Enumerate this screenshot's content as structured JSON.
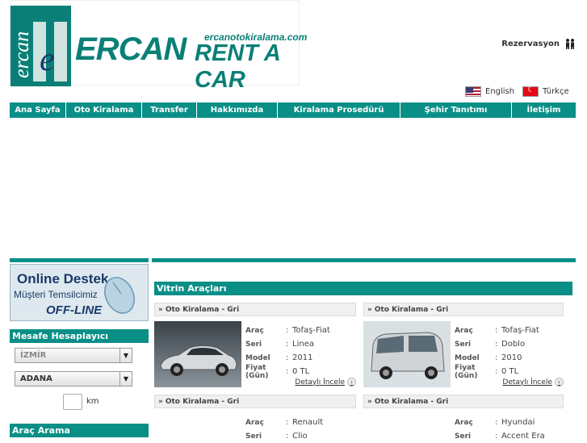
{
  "logo": {
    "mark_text": "ercan",
    "mark_letter": "e",
    "brand": "ERCAN",
    "domain": "ercanotokiralama.com",
    "tagline": "RENT A CAR"
  },
  "header": {
    "reservation_label": "Rezervasyon",
    "reservation_icon": "people-icon",
    "languages": [
      {
        "label": "English",
        "flag": "us-flag-icon"
      },
      {
        "label": "Türkçe",
        "flag": "tr-flag-icon"
      }
    ]
  },
  "nav": [
    {
      "label": "Ana Sayfa"
    },
    {
      "label": "Oto Kiralama"
    },
    {
      "label": "Transfer"
    },
    {
      "label": "Hakkımızda"
    },
    {
      "label": "Kiralama Prosedürü"
    },
    {
      "label": "Şehir Tanıtımı"
    },
    {
      "label": "İletişim"
    }
  ],
  "sidebar": {
    "support": {
      "title": "Online Destek",
      "subtitle": "Müşteri Temsilcimiz",
      "status": "OFF-LINE"
    },
    "distance": {
      "title": "Mesafe Hesaplayıcı",
      "from": "İZMİR",
      "to": "ADANA",
      "km_value": "",
      "km_unit": "km"
    },
    "search": {
      "title": "Araç Arama"
    }
  },
  "vitrin": {
    "title": "Vitrin Araçları",
    "cards": [
      {
        "header": "Oto Kiralama - Gri",
        "arac_label": "Araç",
        "arac": "Tofaş-Fiat",
        "seri_label": "Seri",
        "seri": "Linea",
        "model_label": "Model",
        "model": "2011",
        "fiyat_label": "Fiyat (Gün)",
        "fiyat": "0 TL",
        "detail": "Detaylı İncele"
      },
      {
        "header": "Oto Kiralama - Gri",
        "arac_label": "Araç",
        "arac": "Tofaş-Fiat",
        "seri_label": "Seri",
        "seri": "Doblo",
        "model_label": "Model",
        "model": "2010",
        "fiyat_label": "Fiyat (Gün)",
        "fiyat": "0 TL",
        "detail": "Detaylı İncele"
      },
      {
        "header": "Oto Kiralama - Gri",
        "arac_label": "Araç",
        "arac": "Renault",
        "seri_label": "Seri",
        "seri": "Clio"
      },
      {
        "header": "Oto Kiralama - Gri",
        "arac_label": "Araç",
        "arac": "Hyundai",
        "seri_label": "Seri",
        "seri": "Accent Era"
      }
    ]
  },
  "colors": {
    "accent": "#0a8f87",
    "text": "#333333"
  }
}
